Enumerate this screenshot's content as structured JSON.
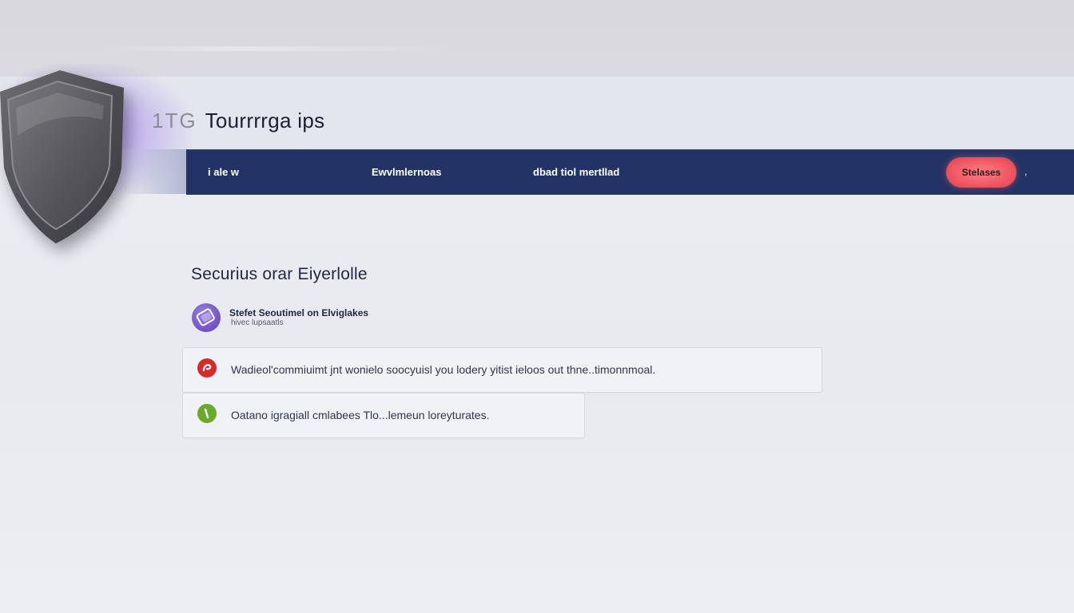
{
  "brand": {
    "mark": "1TG",
    "name": "Tourrrrga ips"
  },
  "nav": {
    "items": [
      {
        "label": "i ale w"
      },
      {
        "label": "Ewvlmlernoas"
      },
      {
        "label": "dbad tiol mertllad"
      }
    ],
    "cta_label": "Stelases",
    "trailing_symbol": ","
  },
  "section": {
    "title": "Securius orar Eiyerlolle"
  },
  "feature": {
    "title": "Stefet Seoutimel on Elviglakes",
    "subtitle": "hivec lupsaatls"
  },
  "alerts": [
    {
      "status": "error",
      "text": "Wadieol'commiuimt jnt wonielo soocyuisl you lodery yitist ieloos out thne..timonnmoal.",
      "color": "#d42b2b"
    },
    {
      "status": "success",
      "text": "Oatano igragiall cmlabees Tlo...lemeun loreyturates.",
      "color": "#6aaa2a"
    }
  ],
  "colors": {
    "navbar": "#233366",
    "cta": "#ef5863",
    "accent_purple": "#7e5cc8"
  },
  "icons": {
    "shield": "shield-icon",
    "feature": "security-badge-icon",
    "error": "error-icon",
    "success": "check-icon"
  }
}
